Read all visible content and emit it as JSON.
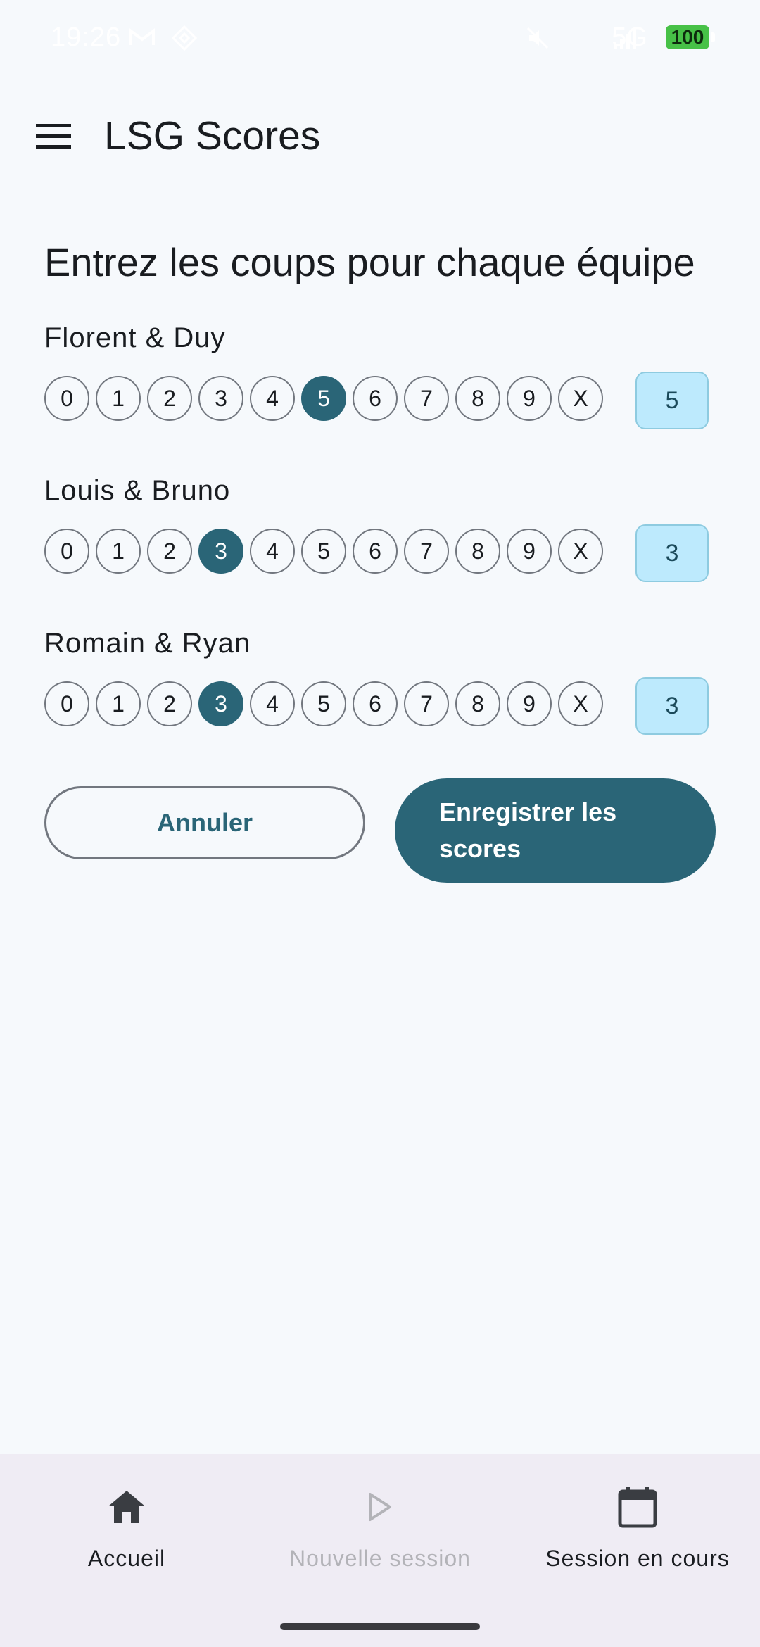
{
  "status_bar": {
    "time": "19:26",
    "network": "5G",
    "battery": "100"
  },
  "app_bar": {
    "title": "LSG Scores"
  },
  "main": {
    "heading": "Entrez les coups pour chaque équipe",
    "chip_options": [
      "0",
      "1",
      "2",
      "3",
      "4",
      "5",
      "6",
      "7",
      "8",
      "9",
      "X"
    ],
    "teams": [
      {
        "name": "Florent & Duy",
        "selected": "5",
        "score": "5"
      },
      {
        "name": "Louis & Bruno",
        "selected": "3",
        "score": "3"
      },
      {
        "name": "Romain & Ryan",
        "selected": "3",
        "score": "3"
      }
    ],
    "cancel_label": "Annuler",
    "save_label": "Enregistrer les scores"
  },
  "bottom_nav": {
    "items": [
      {
        "label": "Accueil",
        "icon": "home-icon",
        "enabled": true
      },
      {
        "label": "Nouvelle session",
        "icon": "play-icon",
        "enabled": false
      },
      {
        "label": "Session en cours",
        "icon": "calendar-icon",
        "enabled": true
      }
    ]
  },
  "colors": {
    "background": "#f6f9fc",
    "primary": "#2a6577",
    "score_box": "#bdeafd",
    "nav_background": "#efecf4"
  }
}
